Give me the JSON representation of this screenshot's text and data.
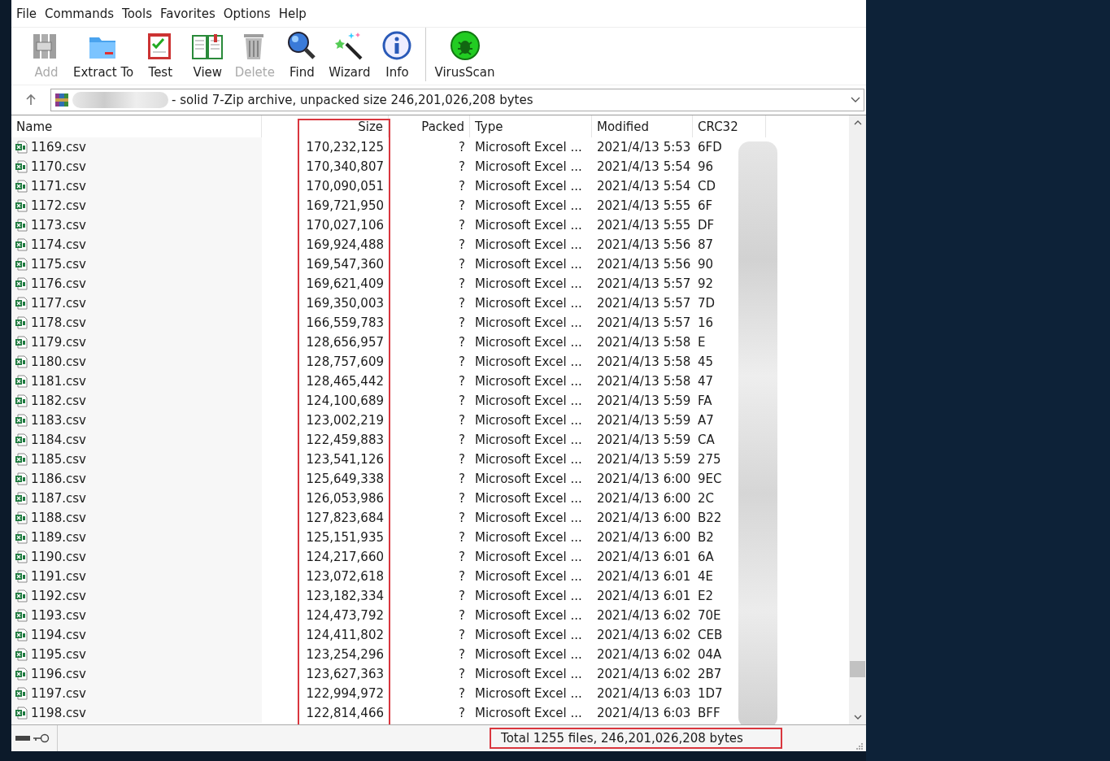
{
  "menu": [
    "File",
    "Commands",
    "Tools",
    "Favorites",
    "Options",
    "Help"
  ],
  "toolbar": [
    {
      "kind": "add",
      "label": "Add",
      "disabled": true
    },
    {
      "kind": "extract",
      "label": "Extract To",
      "disabled": false
    },
    {
      "kind": "test",
      "label": "Test",
      "disabled": false
    },
    {
      "kind": "view",
      "label": "View",
      "disabled": false
    },
    {
      "kind": "delete",
      "label": "Delete",
      "disabled": true
    },
    {
      "kind": "find",
      "label": "Find",
      "disabled": false
    },
    {
      "kind": "wizard",
      "label": "Wizard",
      "disabled": false
    },
    {
      "kind": "info",
      "label": "Info",
      "disabled": false
    },
    {
      "kind": "separator"
    },
    {
      "kind": "virusscan",
      "label": "VirusScan",
      "disabled": false
    }
  ],
  "address": {
    "text": "- solid 7-Zip archive, unpacked size 246,201,026,208 bytes"
  },
  "table": {
    "columns": [
      "Name",
      "Size",
      "Packed",
      "Type",
      "Modified",
      "CRC32"
    ],
    "rows": [
      [
        "1169.csv",
        "170,232,125",
        "?",
        "Microsoft Excel ...",
        "2021/4/13 5:53",
        "6FD"
      ],
      [
        "1170.csv",
        "170,340,807",
        "?",
        "Microsoft Excel ...",
        "2021/4/13 5:54",
        "96"
      ],
      [
        "1171.csv",
        "170,090,051",
        "?",
        "Microsoft Excel ...",
        "2021/4/13 5:54",
        "CD"
      ],
      [
        "1172.csv",
        "169,721,950",
        "?",
        "Microsoft Excel ...",
        "2021/4/13 5:55",
        "6F"
      ],
      [
        "1173.csv",
        "170,027,106",
        "?",
        "Microsoft Excel ...",
        "2021/4/13 5:55",
        "DF"
      ],
      [
        "1174.csv",
        "169,924,488",
        "?",
        "Microsoft Excel ...",
        "2021/4/13 5:56",
        "87"
      ],
      [
        "1175.csv",
        "169,547,360",
        "?",
        "Microsoft Excel ...",
        "2021/4/13 5:56",
        "90"
      ],
      [
        "1176.csv",
        "169,621,409",
        "?",
        "Microsoft Excel ...",
        "2021/4/13 5:57",
        "92"
      ],
      [
        "1177.csv",
        "169,350,003",
        "?",
        "Microsoft Excel ...",
        "2021/4/13 5:57",
        "7D"
      ],
      [
        "1178.csv",
        "166,559,783",
        "?",
        "Microsoft Excel ...",
        "2021/4/13 5:57",
        "16"
      ],
      [
        "1179.csv",
        "128,656,957",
        "?",
        "Microsoft Excel ...",
        "2021/4/13 5:58",
        "E"
      ],
      [
        "1180.csv",
        "128,757,609",
        "?",
        "Microsoft Excel ...",
        "2021/4/13 5:58",
        "45"
      ],
      [
        "1181.csv",
        "128,465,442",
        "?",
        "Microsoft Excel ...",
        "2021/4/13 5:58",
        "47"
      ],
      [
        "1182.csv",
        "124,100,689",
        "?",
        "Microsoft Excel ...",
        "2021/4/13 5:59",
        "FA"
      ],
      [
        "1183.csv",
        "123,002,219",
        "?",
        "Microsoft Excel ...",
        "2021/4/13 5:59",
        "A7"
      ],
      [
        "1184.csv",
        "122,459,883",
        "?",
        "Microsoft Excel ...",
        "2021/4/13 5:59",
        "CA"
      ],
      [
        "1185.csv",
        "123,541,126",
        "?",
        "Microsoft Excel ...",
        "2021/4/13 5:59",
        "275"
      ],
      [
        "1186.csv",
        "125,649,338",
        "?",
        "Microsoft Excel ...",
        "2021/4/13 6:00",
        "9EC"
      ],
      [
        "1187.csv",
        "126,053,986",
        "?",
        "Microsoft Excel ...",
        "2021/4/13 6:00",
        "2C"
      ],
      [
        "1188.csv",
        "127,823,684",
        "?",
        "Microsoft Excel ...",
        "2021/4/13 6:00",
        "B22"
      ],
      [
        "1189.csv",
        "125,151,935",
        "?",
        "Microsoft Excel ...",
        "2021/4/13 6:00",
        "B2"
      ],
      [
        "1190.csv",
        "124,217,660",
        "?",
        "Microsoft Excel ...",
        "2021/4/13 6:01",
        "6A"
      ],
      [
        "1191.csv",
        "123,072,618",
        "?",
        "Microsoft Excel ...",
        "2021/4/13 6:01",
        "4E"
      ],
      [
        "1192.csv",
        "123,182,334",
        "?",
        "Microsoft Excel ...",
        "2021/4/13 6:01",
        "E2"
      ],
      [
        "1193.csv",
        "124,473,792",
        "?",
        "Microsoft Excel ...",
        "2021/4/13 6:02",
        "70E"
      ],
      [
        "1194.csv",
        "124,411,802",
        "?",
        "Microsoft Excel ...",
        "2021/4/13 6:02",
        "CEB"
      ],
      [
        "1195.csv",
        "123,254,296",
        "?",
        "Microsoft Excel ...",
        "2021/4/13 6:02",
        "04A"
      ],
      [
        "1196.csv",
        "123,627,363",
        "?",
        "Microsoft Excel ...",
        "2021/4/13 6:02",
        "2B7"
      ],
      [
        "1197.csv",
        "122,994,972",
        "?",
        "Microsoft Excel ...",
        "2021/4/13 6:03",
        "1D7"
      ],
      [
        "1198.csv",
        "122,814,466",
        "?",
        "Microsoft Excel ...",
        "2021/4/13 6:03",
        "BFF"
      ]
    ]
  },
  "status_bar": {
    "text": "Total 1255 files, 246,201,026,208 bytes"
  }
}
